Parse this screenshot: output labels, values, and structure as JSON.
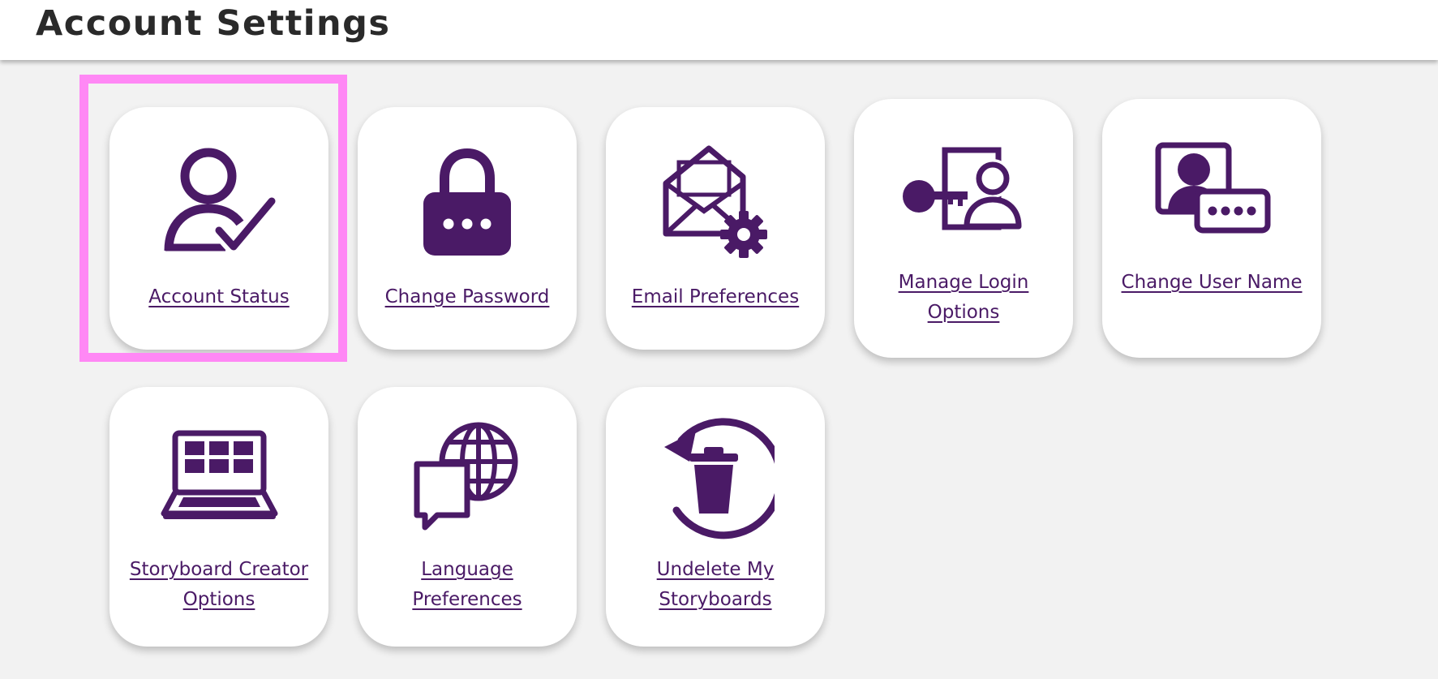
{
  "header": {
    "title": "Account Settings"
  },
  "colors": {
    "accent": "#4a1a66",
    "highlight": "#ff88f5",
    "background": "#f2f2f2",
    "card": "#ffffff"
  },
  "cards": [
    {
      "label": "Account Status",
      "icon": "user-check-icon",
      "selected": true
    },
    {
      "label": "Change Password",
      "icon": "padlock-icon"
    },
    {
      "label": "Email Preferences",
      "icon": "envelope-gear-icon"
    },
    {
      "label": "Manage Login Options",
      "icon": "key-user-icon"
    },
    {
      "label": "Change User Name",
      "icon": "user-id-password-icon"
    },
    {
      "label": "Storyboard Creator Options",
      "icon": "laptop-grid-icon"
    },
    {
      "label": "Language Preferences",
      "icon": "globe-chat-icon"
    },
    {
      "label": "Undelete My Storyboards",
      "icon": "trash-restore-icon"
    }
  ]
}
